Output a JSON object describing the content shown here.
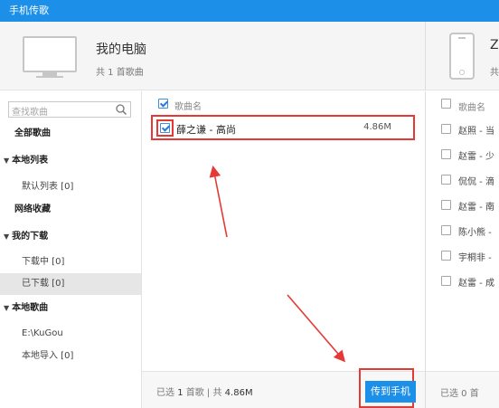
{
  "window": {
    "title": "手机传歌"
  },
  "computer": {
    "title": "我的电脑",
    "count": "共 1 首歌曲"
  },
  "phone": {
    "title": "ZU",
    "count": "共"
  },
  "sidebar": {
    "search_placeholder": "查找歌曲",
    "items": [
      {
        "label": "全部歌曲"
      },
      {
        "label": "本地列表"
      },
      {
        "label": "默认列表 [0]"
      },
      {
        "label": "网络收藏"
      },
      {
        "label": "我的下载"
      },
      {
        "label": "下载中 [0]"
      },
      {
        "label": "已下载 [0]"
      },
      {
        "label": "本地歌曲"
      },
      {
        "label": "E:\\KuGou"
      },
      {
        "label": "本地导入 [0]"
      }
    ]
  },
  "song_list": {
    "column_header": "歌曲名",
    "songs": [
      {
        "title": "薛之谦 - 高尚",
        "size": "4.86M",
        "checked": true
      }
    ]
  },
  "footer": {
    "selected_prefix": "已选",
    "selected_count": "1",
    "selected_suffix": "首歌",
    "total_prefix": "共",
    "total_size": "4.86M",
    "send_button": "传到手机"
  },
  "phone_list": {
    "column_header": "歌曲名",
    "songs": [
      {
        "title": "赵照 - 当"
      },
      {
        "title": "赵雷 - 少"
      },
      {
        "title": "侃侃 - 滴"
      },
      {
        "title": "赵雷 - 南"
      },
      {
        "title": "陈小熊 -"
      },
      {
        "title": "宇桐非 -"
      },
      {
        "title": "赵雷 - 成"
      }
    ],
    "footer": "已选 0 首"
  },
  "colors": {
    "titlebar": "#1c8fe8",
    "highlight": "#e53935",
    "button": "#1c8fe8"
  }
}
